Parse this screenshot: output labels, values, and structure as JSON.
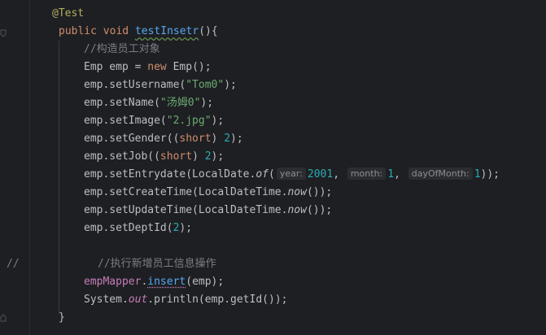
{
  "editor": {
    "annotation": "@Test",
    "method_kw_public": "public",
    "method_kw_void": "void",
    "method_name": "testInsetr",
    "method_tail": "(){",
    "comment_construct": "//构造员工对象",
    "l_emp_type": "Emp emp = ",
    "l_emp_new": "new",
    "l_emp_ctor": " Emp();",
    "setUsername": "emp.setUsername(",
    "username_val": "\"Tom0\"",
    "setName": "emp.setName(",
    "name_val": "\"汤姆0\"",
    "setImage": "emp.setImage(",
    "image_val": "\"2.jpg\"",
    "setGender": "emp.setGender((",
    "short_kw": "short",
    "gender_mid": ") ",
    "gender_val": "2",
    "setJob": "emp.setJob((",
    "job_val": "2",
    "setEntrydate": "emp.setEntrydate(LocalDate.",
    "of_fn": "of",
    "hint_year": "year:",
    "year_val": "2001",
    "hint_month": "month:",
    "month_val": "1",
    "hint_day": "dayOfMonth:",
    "day_val": "1",
    "setCreateTime": "emp.setCreateTime(LocalDateTime.",
    "now_fn": "now",
    "setUpdateTime": "emp.setUpdateTime(LocalDateTime.",
    "setDeptId": "emp.setDeptId(",
    "dept_val": "2",
    "gutter_comment": "//",
    "comment_insert": "//执行新增员工信息操作",
    "mapper_var": "empMapper",
    "insert_fn": "insert",
    "insert_args": "(emp);",
    "println_pre": "System.",
    "out_field": "out",
    "println_post": ".println(emp.getId());",
    "close_brace": "}"
  }
}
